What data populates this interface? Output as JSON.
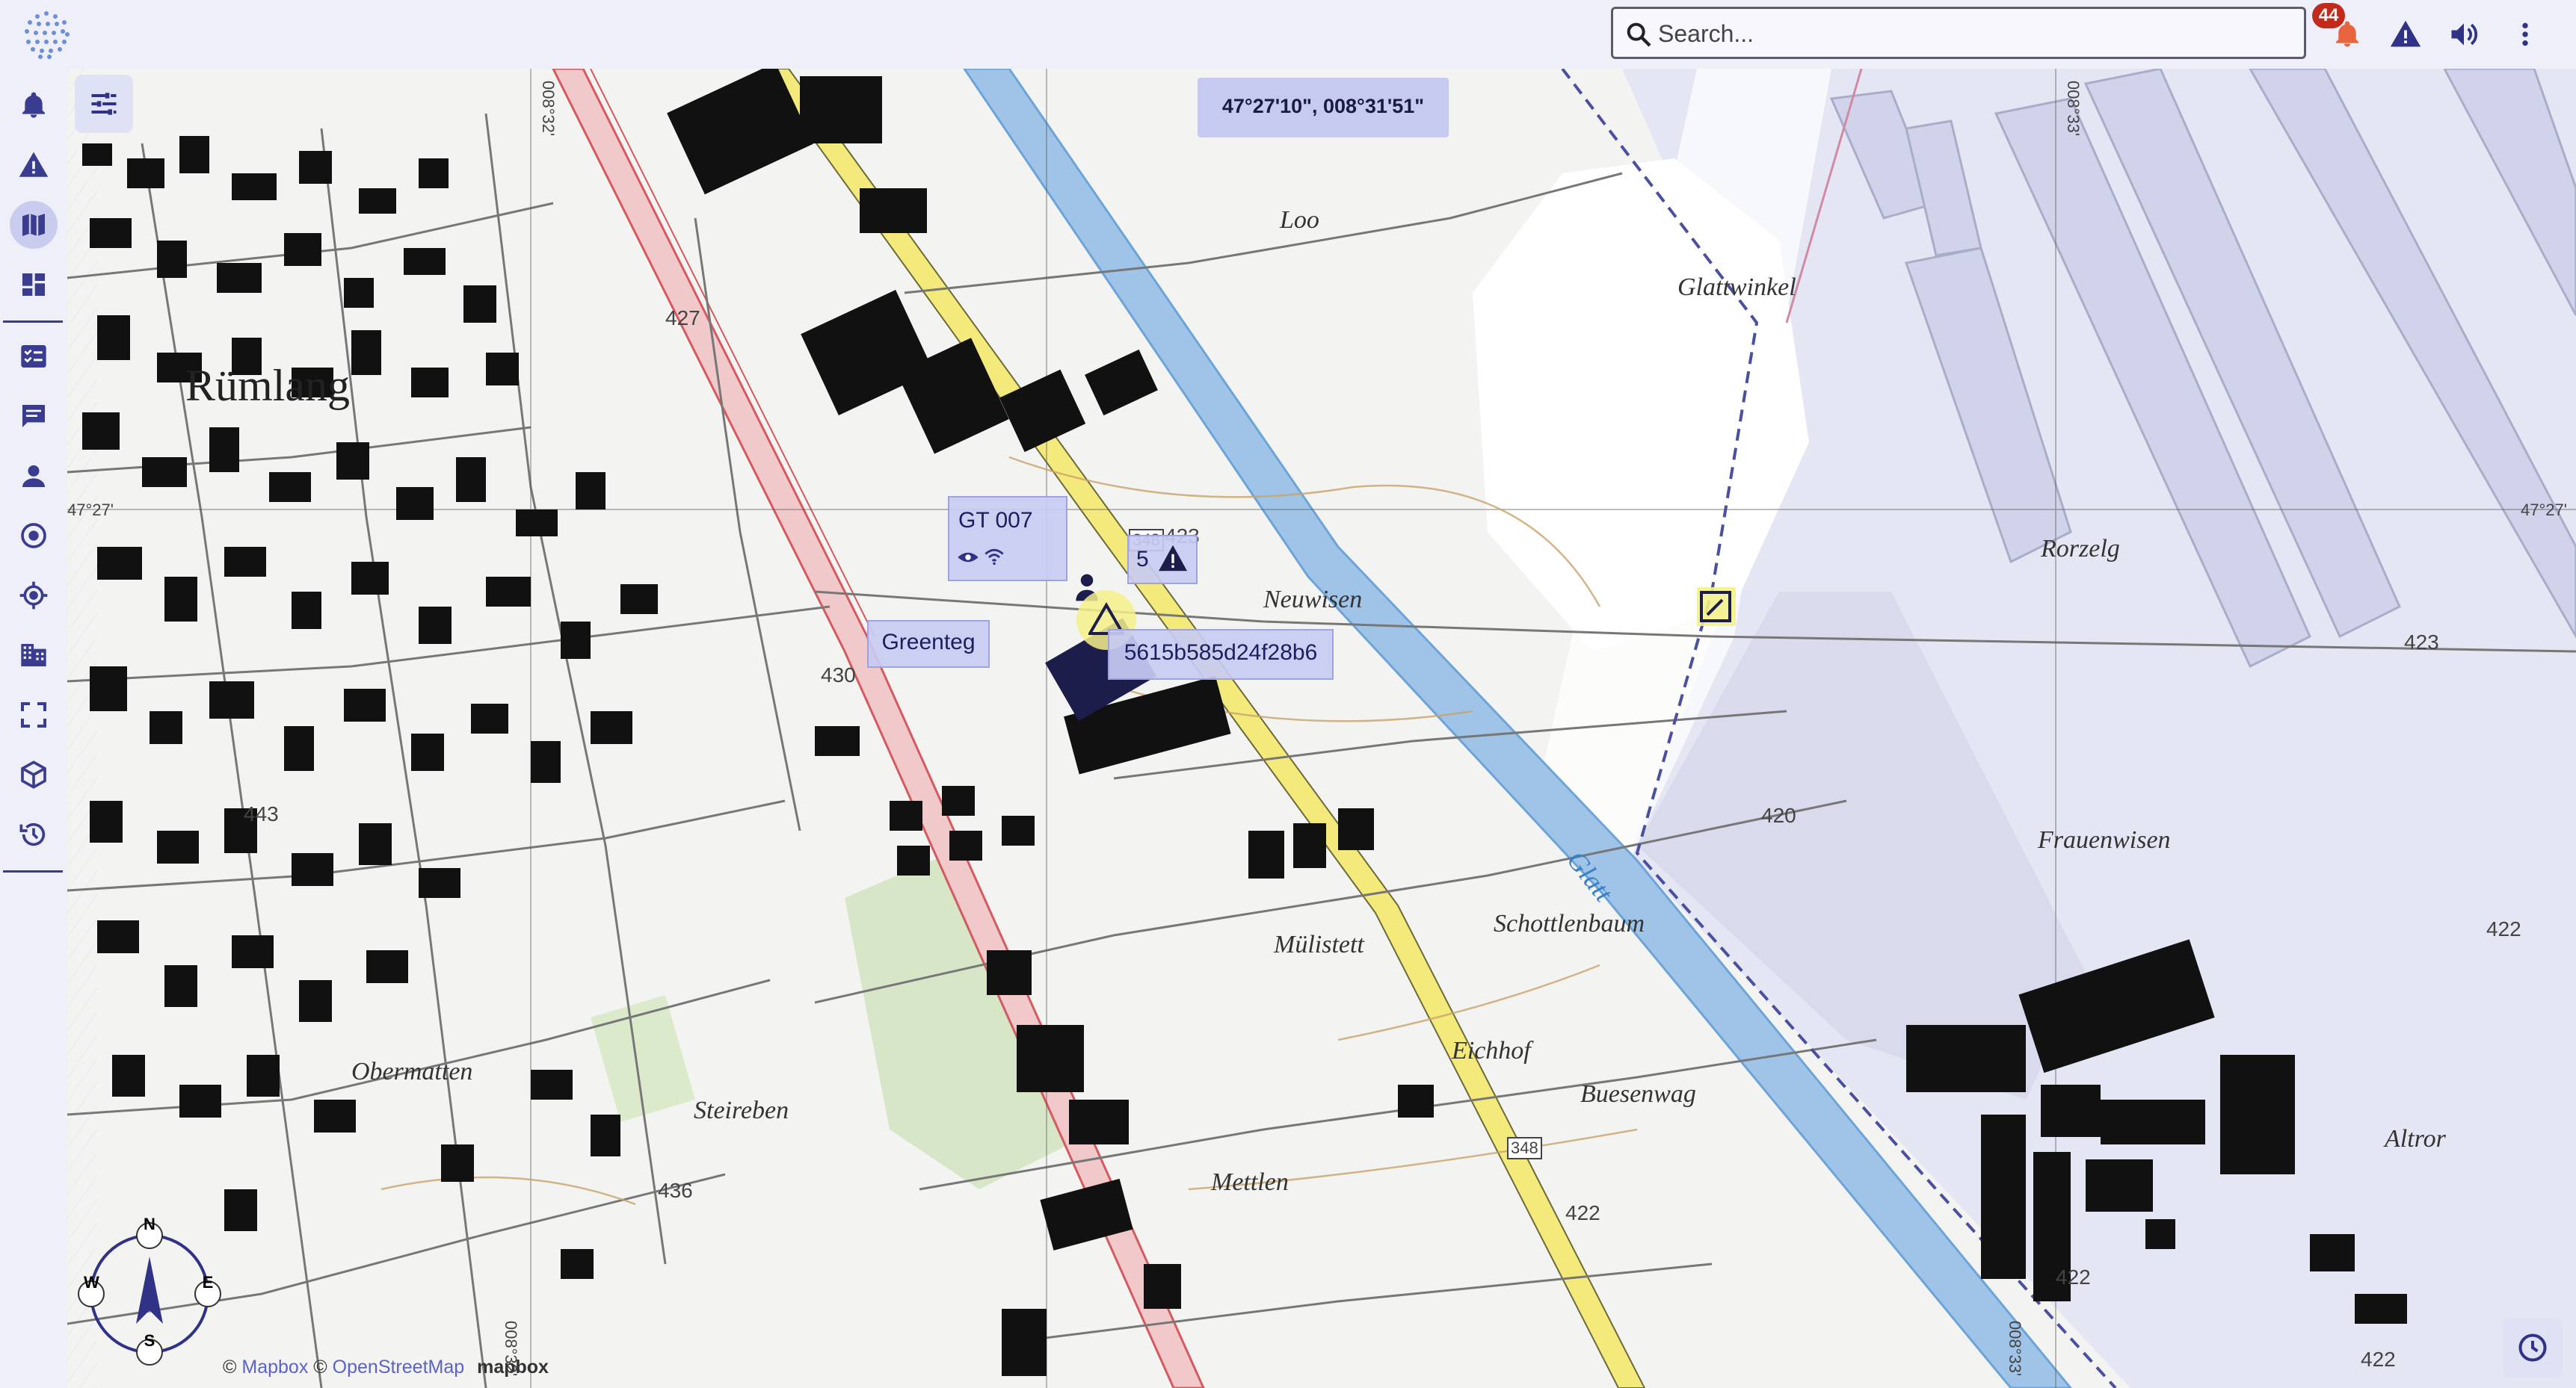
{
  "search": {
    "placeholder": "Search..."
  },
  "notifications": {
    "count": "44"
  },
  "icons": {
    "logo": "hex-dot-logo",
    "search": "search-icon",
    "notifications": "bell-icon",
    "alerts": "warning-icon",
    "sound": "volume-icon",
    "menu": "more-vert-icon"
  },
  "sidebar": {
    "items": [
      {
        "icon": "bell-icon",
        "active": false
      },
      {
        "icon": "warning-icon",
        "active": false
      },
      {
        "icon": "map-icon",
        "active": true
      },
      {
        "icon": "dashboard-icon",
        "active": false
      },
      {
        "icon": "checklist-icon",
        "active": false
      },
      {
        "icon": "chat-icon",
        "active": false
      },
      {
        "icon": "person-icon",
        "active": false
      },
      {
        "icon": "target-icon",
        "active": false
      },
      {
        "icon": "location-crosshair-icon",
        "active": false
      },
      {
        "icon": "building-icon",
        "active": false
      },
      {
        "icon": "fullscreen-icon",
        "active": false
      },
      {
        "icon": "cube-icon",
        "active": false
      },
      {
        "icon": "history-icon",
        "active": false
      }
    ]
  },
  "map": {
    "coordinate": "47°27'10\", 008°31'51\"",
    "places": [
      "Rümlang",
      "Loo",
      "Glattwinkel",
      "Rorzelg",
      "Neuwisen",
      "Frauenwisen",
      "Schottlenbaum",
      "Mülistett",
      "Eichhof",
      "Buesenwag",
      "Obermatten",
      "Steireben",
      "Mettlen",
      "Altror",
      "Glatt"
    ],
    "elevations": [
      "427",
      "430",
      "443",
      "436",
      "420",
      "423",
      "422",
      "422",
      "422",
      "422",
      "423"
    ],
    "road_numbers": [
      "348",
      "348"
    ],
    "grid_labels": [
      "47°27'",
      "47°27'",
      "008°32'",
      "008°33'",
      "008°32'",
      "008°33'"
    ],
    "markers": {
      "device": {
        "name": "GT 007"
      },
      "cluster": {
        "count": "5"
      },
      "zone": {
        "name": "Greenteg"
      },
      "id": {
        "text": "5615b585d24f28b6"
      }
    },
    "compass": {
      "n": "N",
      "e": "E",
      "s": "S",
      "w": "W"
    },
    "attribution": {
      "c1": "©",
      "l1": "Mapbox",
      "c2": "©",
      "l2": "OpenStreetMap",
      "logo": "mapbox"
    }
  },
  "colors": {
    "accent": "#3a3d8f",
    "badge": "#c22a1c",
    "panel": "#eeeff8",
    "highlight": "#c6c9f0"
  }
}
